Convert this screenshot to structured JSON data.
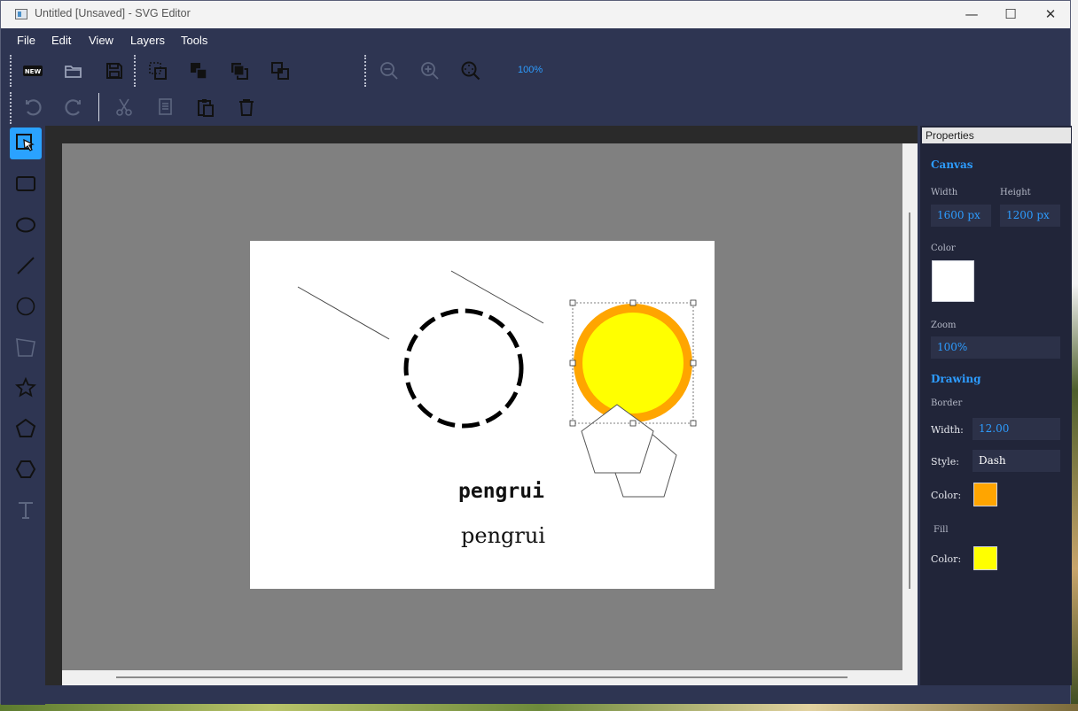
{
  "window": {
    "title": "Untitled [Unsaved] - SVG Editor",
    "controls": {
      "minimize": "—",
      "maximize": "☐",
      "close": "✕"
    }
  },
  "menu": [
    "File",
    "Edit",
    "View",
    "Layers",
    "Tools"
  ],
  "toolbar": {
    "row1": [
      {
        "name": "new-icon"
      },
      {
        "name": "open-folder-icon"
      },
      {
        "name": "save-icon"
      },
      {
        "name": "select-area-icon"
      },
      {
        "name": "bring-forward-icon"
      },
      {
        "name": "send-backward-icon"
      },
      {
        "name": "arrange-icon"
      },
      {
        "name": "zoom-out-icon"
      },
      {
        "name": "zoom-in-icon"
      },
      {
        "name": "zoom-fit-icon"
      }
    ],
    "zoom_label": "100%",
    "row2": [
      {
        "name": "undo-icon"
      },
      {
        "name": "redo-icon"
      },
      {
        "name": "cut-icon"
      },
      {
        "name": "copy-icon"
      },
      {
        "name": "paste-icon"
      },
      {
        "name": "delete-icon"
      }
    ],
    "new_label": "NEW"
  },
  "tools": [
    {
      "name": "select-tool-icon",
      "active": true
    },
    {
      "name": "rectangle-tool-icon"
    },
    {
      "name": "ellipse-tool-icon"
    },
    {
      "name": "line-tool-icon"
    },
    {
      "name": "circle-tool-icon"
    },
    {
      "name": "polygon-tool-icon"
    },
    {
      "name": "star-tool-icon"
    },
    {
      "name": "pentagon-tool-icon"
    },
    {
      "name": "hexagon-tool-icon"
    },
    {
      "name": "text-tool-icon"
    }
  ],
  "canvas_content": {
    "texts": [
      "pengrui",
      "pengrui"
    ],
    "circle_stroke": "#000000",
    "selected_circle": {
      "fill": "#ffff00",
      "stroke": "#ffa500"
    }
  },
  "properties": {
    "header": "Properties",
    "canvas": {
      "title": "Canvas",
      "width_label": "Width",
      "height_label": "Height",
      "width_value": "1600 px",
      "height_value": "1200 px",
      "color_label": "Color",
      "color": "#ffffff",
      "zoom_label": "Zoom",
      "zoom_value": "100%"
    },
    "drawing": {
      "title": "Drawing",
      "border_label": "Border",
      "width_label": "Width:",
      "width_value": "12.00",
      "style_label": "Style:",
      "style_value": "Dash",
      "color_label": "Color:",
      "border_color": "#ffa500",
      "fill_label": "Fill",
      "fill_color_label": "Color:",
      "fill_color": "#ffff00"
    }
  }
}
